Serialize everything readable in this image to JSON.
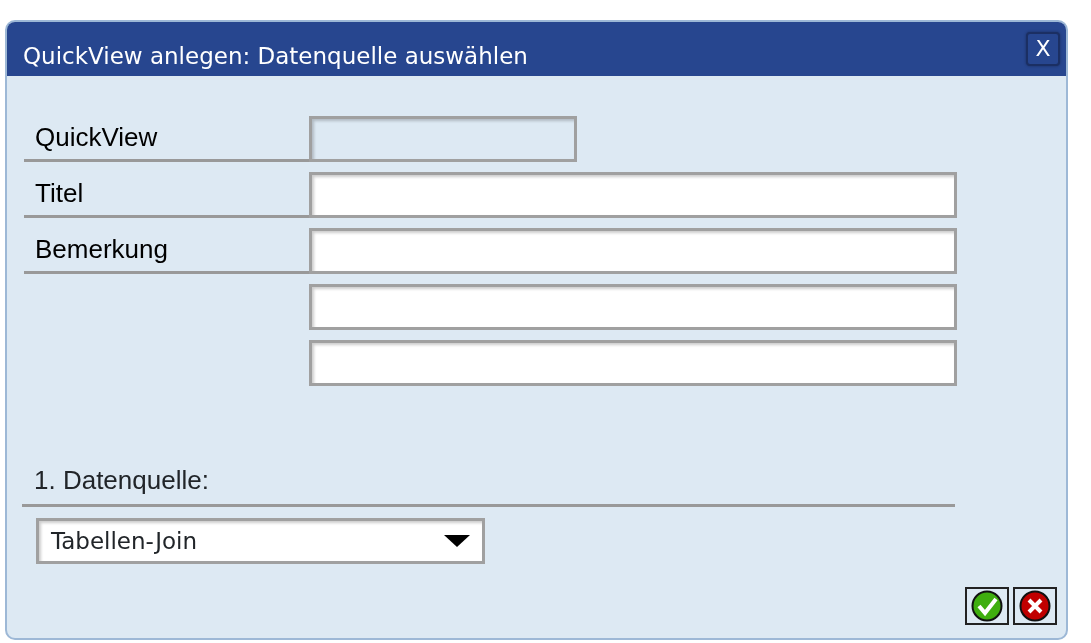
{
  "window": {
    "title": "QuickView anlegen: Datenquelle auswählen",
    "close_label": "X"
  },
  "fields": [
    {
      "label": "QuickView",
      "disabled": true
    },
    {
      "label": "Titel",
      "disabled": false
    },
    {
      "label": "Bemerkung",
      "disabled": false
    },
    {
      "disabled": false
    },
    {
      "disabled": false
    }
  ],
  "datasource": {
    "label": "1. Datenquelle:",
    "value": "Tabellen-Join"
  },
  "buttons": [
    {
      "kind": "confirm"
    },
    {
      "kind": "cancel"
    }
  ]
}
